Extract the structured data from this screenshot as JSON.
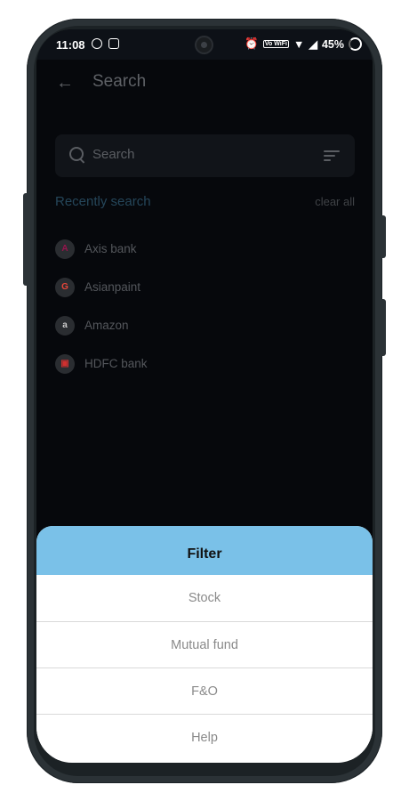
{
  "status_bar": {
    "time": "11:08",
    "vowifi": "Vo WiFi",
    "battery": "45%"
  },
  "header": {
    "title": "Search",
    "back_icon": "arrow-left-icon"
  },
  "search": {
    "placeholder": "Search",
    "icon": "search-icon",
    "filter_icon": "filter-icon"
  },
  "recent": {
    "title": "Recently search",
    "clear_label": "clear all",
    "items": [
      {
        "name": "Axis bank",
        "logo_glyph": "A",
        "logo_color": "#97144d"
      },
      {
        "name": "Asianpaint",
        "logo_glyph": "G",
        "logo_color": "#e8463a"
      },
      {
        "name": "Amazon",
        "logo_glyph": "a",
        "logo_color": "#cccccc"
      },
      {
        "name": "HDFC bank",
        "logo_glyph": "▣",
        "logo_color": "#d0302f"
      }
    ]
  },
  "filter_sheet": {
    "title": "Filter",
    "header_color": "#7ac1e8",
    "options": [
      "Stock",
      "Mutual fund",
      "F&O",
      "Help"
    ]
  }
}
